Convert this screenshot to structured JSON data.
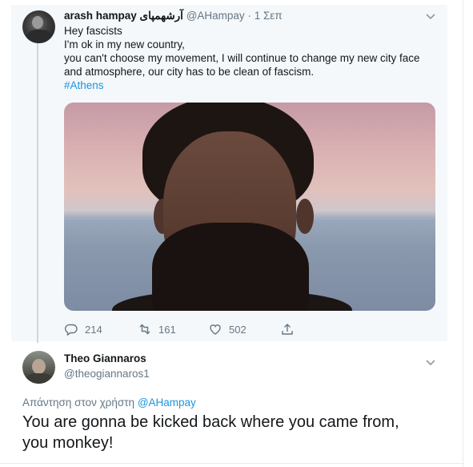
{
  "tweet": {
    "author_name": "arash hampay آرشهمپای",
    "author_handle": "@AHampay",
    "separator": "·",
    "time": "1 Σεπ",
    "text_lines": [
      "Hey fascists",
      "I'm ok in my new country,",
      "you can't choose my movement, I will continue to change my new city face",
      "and atmosphere, our city has to be clean of fascism."
    ],
    "hashtag": "#Athens",
    "counts": {
      "replies": "214",
      "retweets": "161",
      "likes": "502"
    },
    "icons": {
      "reply": "reply-icon",
      "retweet": "retweet-icon",
      "like": "heart-icon",
      "share": "share-icon",
      "menu": "chevron-down-icon"
    }
  },
  "reply": {
    "author_name": "Theo Giannaros",
    "author_handle": "@theogiannaros1",
    "replying_to_label": "Απάντηση στον χρήστη",
    "replying_to_handle": "@AHampay",
    "text_lines": [
      "You are gonna be kicked back where you came from,",
      "you monkey!"
    ]
  },
  "colors": {
    "link": "#1b95e0",
    "muted": "#657786",
    "text": "#14171a",
    "panel": "#f5f8fa",
    "thread_line": "#ccd6dd"
  }
}
